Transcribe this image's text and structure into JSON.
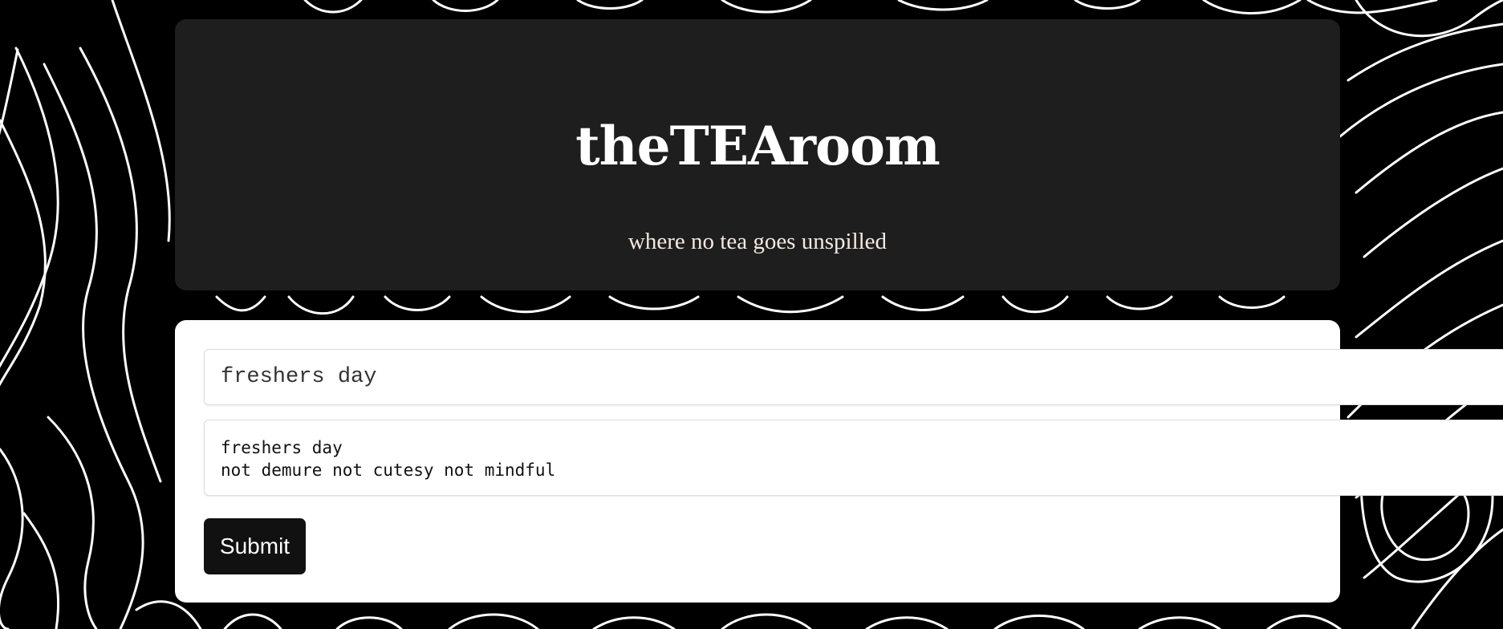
{
  "header": {
    "title": "theTEAroom",
    "tagline": "where no tea goes unspilled"
  },
  "form": {
    "title_value": "freshers day",
    "body_value": "freshers day\nnot demure not cutesy not mindful",
    "submit_label": "Submit"
  },
  "colors": {
    "background": "#000000",
    "header_card": "#1e1e1e",
    "form_card": "#ffffff",
    "button": "#111111",
    "tagline": "#f6e9e2"
  }
}
